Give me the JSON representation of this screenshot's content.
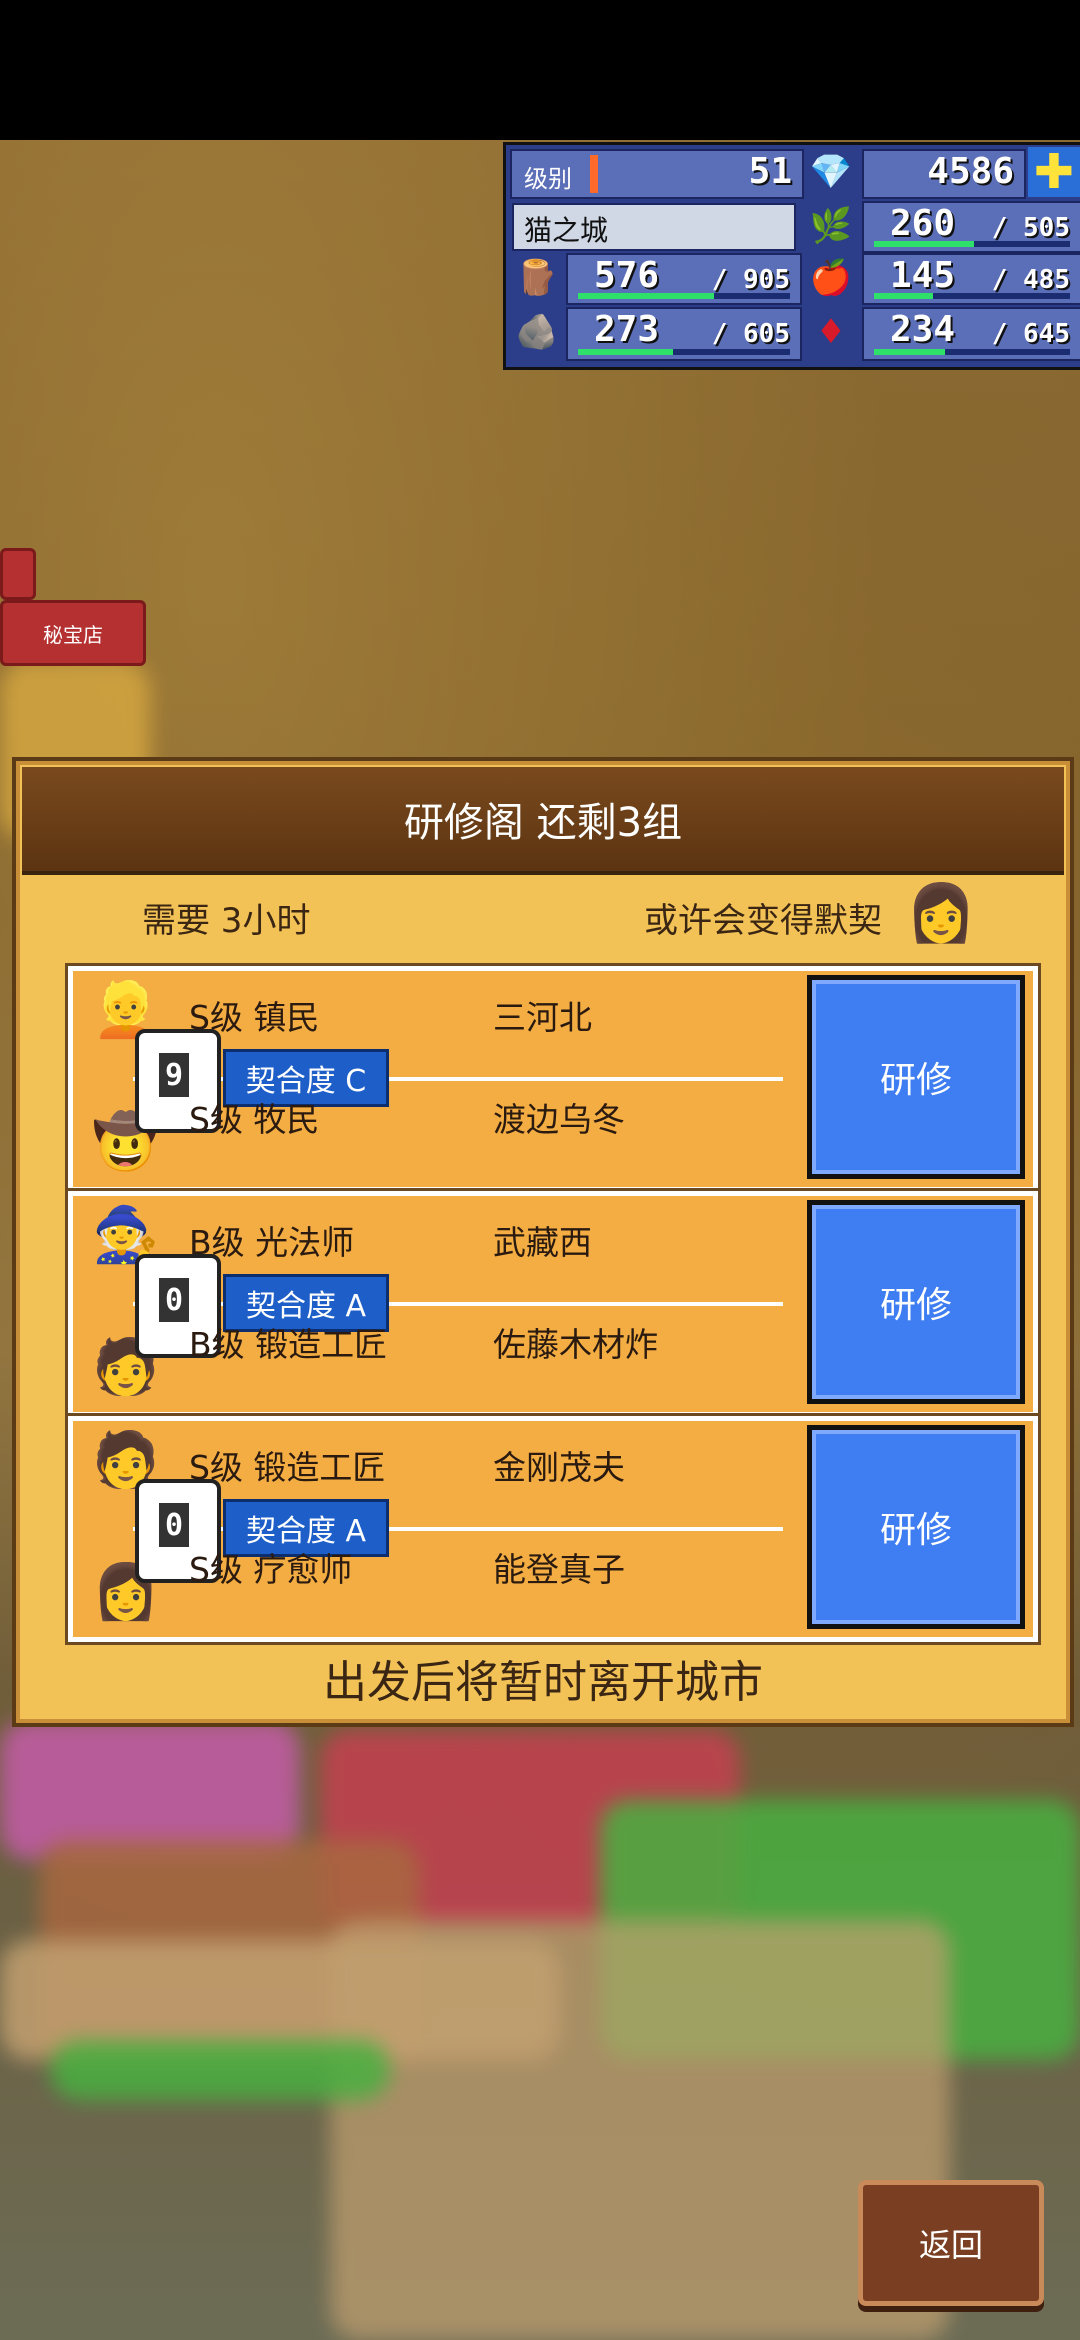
{
  "status": {
    "level_label": "级别",
    "level": "51",
    "gems": "4586",
    "plus_icon": "plus-icon",
    "town_name": "猫之城",
    "resources": [
      {
        "icon": "crop-icon",
        "value": "260",
        "max": "/ 505",
        "fill": 0.51
      },
      {
        "icon": "wood-icon",
        "value": "576",
        "max": "/ 905",
        "fill": 0.64
      },
      {
        "icon": "food-icon",
        "value": "145",
        "max": "/ 485",
        "fill": 0.3
      },
      {
        "icon": "stone-icon",
        "value": "273",
        "max": "/ 605",
        "fill": 0.45
      },
      {
        "icon": "ruby-icon",
        "value": "234",
        "max": "/ 645",
        "fill": 0.36
      }
    ]
  },
  "side": {
    "shop_label": "秘宝店"
  },
  "dialog": {
    "title": "研修阁 还剩3组",
    "required_time": "需要 3小时",
    "hint": "或许会变得默契",
    "footer": "出发后将暂时离开城市",
    "teams": [
      {
        "card_number": "9",
        "fit": "契合度 C",
        "top_role": "S级 镇民",
        "top_name": "三河北",
        "bottom_role": "S级 牧民",
        "bottom_name": "渡边乌冬",
        "button": "研修"
      },
      {
        "card_number": "0",
        "fit": "契合度 A",
        "top_role": "B级 光法师",
        "top_name": "武藏西",
        "bottom_role": "B级 锻造工匠",
        "bottom_name": "佐藤木材炸",
        "button": "研修"
      },
      {
        "card_number": "0",
        "fit": "契合度 A",
        "top_role": "S级 锻造工匠",
        "top_name": "金刚茂夫",
        "bottom_role": "S级 疗愈师",
        "bottom_name": "能登真子",
        "button": "研修"
      }
    ]
  },
  "back_label": "返回"
}
